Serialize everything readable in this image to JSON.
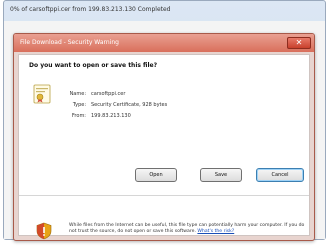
{
  "browser_window": {
    "title": "0% of carsoftppi.cer from 199.83.213.130 Completed"
  },
  "dialog": {
    "title": "File Download - Security Warning",
    "close_label": "✕",
    "question": "Do you want to open or save this file?",
    "file_info": {
      "name_label": "Name:",
      "name_value": "carsoftppi.cer",
      "type_label": "Type:",
      "type_value": "Security Certificate, 928 bytes",
      "from_label": "From:",
      "from_value": "199.83.213.130"
    },
    "buttons": {
      "open": "Open",
      "save": "Save",
      "cancel": "Cancel"
    },
    "warning": {
      "text": "While files from the Internet can be useful, this file type can potentially harm your computer. If you do not trust the source, do not open or save this software.",
      "link": "What's the risk?"
    }
  },
  "colors": {
    "titlebar": "#d96f5b",
    "dialog_bg": "#e8d4cf",
    "link": "#1a4fb8"
  },
  "icons": {
    "file": "certificate-file-icon",
    "warning": "shield-warning-icon"
  }
}
